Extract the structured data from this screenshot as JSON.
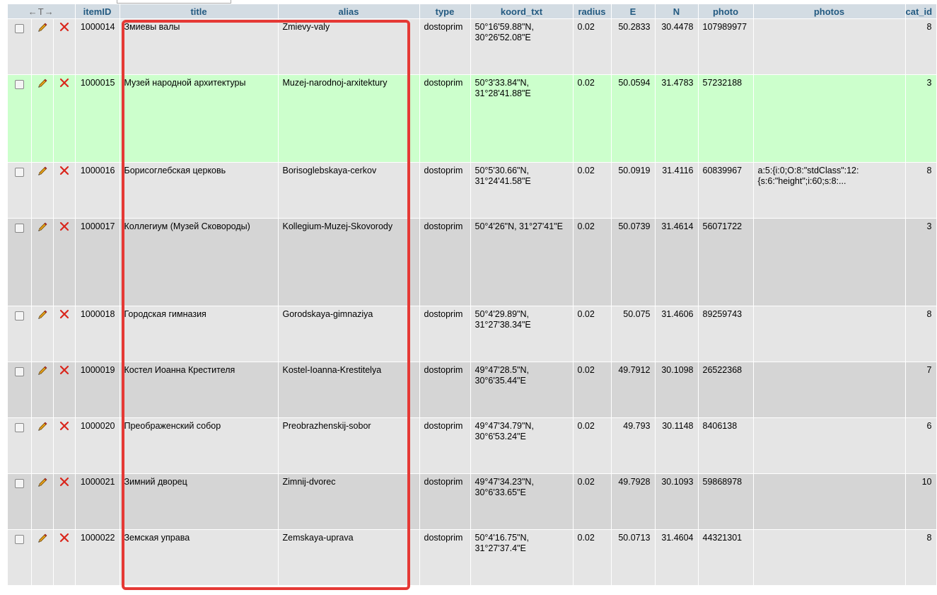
{
  "columns": {
    "arrows": "←T→",
    "itemID": "itemID",
    "title": "title",
    "alias": "alias",
    "type": "type",
    "koord_txt": "koord_txt",
    "radius": "radius",
    "E": "E",
    "N": "N",
    "photo": "photo",
    "photos": "photos",
    "cat_id": "cat_id"
  },
  "rows": [
    {
      "itemID": "1000014",
      "title": "Змиевы валы",
      "alias": "Zmievy-valy",
      "type": "dostoprim",
      "koord_txt": "50°16'59.88\"N, 30°26'52.08\"E",
      "radius": "0.02",
      "E": "50.2833",
      "N": "30.4478",
      "photo": "107989977",
      "photos": "",
      "cat_id": "8"
    },
    {
      "itemID": "1000015",
      "title": "Музей народной архитектуры",
      "alias": "Muzej-narodnoj-arxitektury",
      "type": "dostoprim",
      "koord_txt": "50°3'33.84\"N, 31°28'41.88\"E",
      "radius": "0.02",
      "E": "50.0594",
      "N": "31.4783",
      "photo": "57232188",
      "photos": "",
      "cat_id": "3"
    },
    {
      "itemID": "1000016",
      "title": "Борисоглебская церковь",
      "alias": "Borisoglebskaya-cerkov",
      "type": "dostoprim",
      "koord_txt": "50°5'30.66\"N, 31°24'41.58\"E",
      "radius": "0.02",
      "E": "50.0919",
      "N": "31.4116",
      "photo": "60839967",
      "photos": "a:5:{i:0;O:8:\"stdClass\":12:{s:6:\"height\";i:60;s:8:...",
      "cat_id": "8"
    },
    {
      "itemID": "1000017",
      "title": "Коллегиум (Музей Сковороды)",
      "alias": "Kollegium-Muzej-Skovorody",
      "type": "dostoprim",
      "koord_txt": "50°4'26\"N, 31°27'41\"E",
      "radius": "0.02",
      "E": "50.0739",
      "N": "31.4614",
      "photo": "56071722",
      "photos": "",
      "cat_id": "3"
    },
    {
      "itemID": "1000018",
      "title": "Городская гимназия",
      "alias": "Gorodskaya-gimnaziya",
      "type": "dostoprim",
      "koord_txt": "50°4'29.89\"N, 31°27'38.34\"E",
      "radius": "0.02",
      "E": "50.075",
      "N": "31.4606",
      "photo": "89259743",
      "photos": "",
      "cat_id": "8"
    },
    {
      "itemID": "1000019",
      "title": "Костел Иоанна Крестителя",
      "alias": "Kostel-Ioanna-Krestitelya",
      "type": "dostoprim",
      "koord_txt": "49°47'28.5\"N, 30°6'35.44\"E",
      "radius": "0.02",
      "E": "49.7912",
      "N": "30.1098",
      "photo": "26522368",
      "photos": "",
      "cat_id": "7"
    },
    {
      "itemID": "1000020",
      "title": "Преображенский собор",
      "alias": "Preobrazhenskij-sobor",
      "type": "dostoprim",
      "koord_txt": "49°47'34.79\"N, 30°6'53.24\"E",
      "radius": "0.02",
      "E": "49.793",
      "N": "30.1148",
      "photo": "8406138",
      "photos": "",
      "cat_id": "6"
    },
    {
      "itemID": "1000021",
      "title": "Зимний дворец",
      "alias": "Zimnij-dvorec",
      "type": "dostoprim",
      "koord_txt": "49°47'34.23\"N, 30°6'33.65\"E",
      "radius": "0.02",
      "E": "49.7928",
      "N": "30.1093",
      "photo": "59868978",
      "photos": "",
      "cat_id": "10"
    },
    {
      "itemID": "1000022",
      "title": "Земская управа",
      "alias": "Zemskaya-uprava",
      "type": "dostoprim",
      "koord_txt": "50°4'16.75\"N, 31°27'37.4\"E",
      "radius": "0.02",
      "E": "50.0713",
      "N": "31.4604",
      "photo": "44321301",
      "photos": "",
      "cat_id": "8"
    }
  ],
  "colors": {
    "header_bg": "#d3dce3",
    "header_text": "#235a81",
    "row_odd": "#e5e5e5",
    "row_even": "#d5d5d5",
    "row_marked": "#ccffcc",
    "highlight_border": "#e53935"
  },
  "icons": {
    "edit": "pencil-icon",
    "delete": "delete-x-icon"
  }
}
